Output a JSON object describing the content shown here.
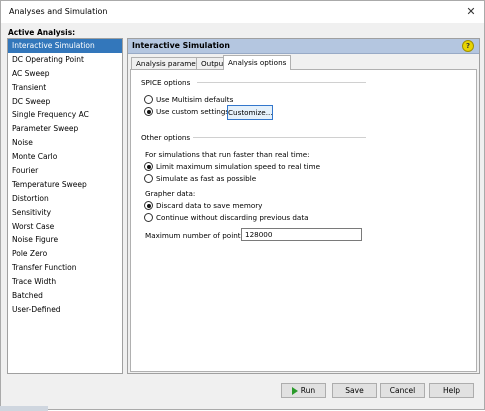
{
  "window": {
    "title": "Analyses and Simulation"
  },
  "sidebar": {
    "label": "Active Analysis:",
    "items": [
      {
        "label": "Interactive Simulation",
        "selected": true
      },
      {
        "label": "DC Operating Point"
      },
      {
        "label": "AC Sweep"
      },
      {
        "label": "Transient"
      },
      {
        "label": "DC Sweep"
      },
      {
        "label": "Single Frequency AC"
      },
      {
        "label": "Parameter Sweep"
      },
      {
        "label": "Noise"
      },
      {
        "label": "Monte Carlo"
      },
      {
        "label": "Fourier"
      },
      {
        "label": "Temperature Sweep"
      },
      {
        "label": "Distortion"
      },
      {
        "label": "Sensitivity"
      },
      {
        "label": "Worst Case"
      },
      {
        "label": "Noise Figure"
      },
      {
        "label": "Pole Zero"
      },
      {
        "label": "Transfer Function"
      },
      {
        "label": "Trace Width"
      },
      {
        "label": "Batched"
      },
      {
        "label": "User-Defined"
      }
    ]
  },
  "panel": {
    "title": "Interactive Simulation",
    "help_icon": "help-icon",
    "tabs": [
      {
        "label": "Analysis parameters"
      },
      {
        "label": "Output"
      },
      {
        "label": "Analysis options",
        "active": true
      }
    ]
  },
  "options": {
    "spice_group": "SPICE options",
    "spice_defaults": "Use Multisim defaults",
    "spice_custom": "Use custom settings",
    "customize_button": "Customize...",
    "other_group": "Other options",
    "faster_label": "For simulations that run faster than real time:",
    "limit_speed": "Limit maximum simulation speed to real time",
    "fast_possible": "Simulate as fast as possible",
    "grapher_label": "Grapher data:",
    "discard_data": "Discard data to save memory",
    "continue_data": "Continue without discarding previous data",
    "max_points_label": "Maximum number of points:",
    "max_points_value": "128000"
  },
  "buttons": {
    "run": "Run",
    "save": "Save",
    "cancel": "Cancel",
    "help": "Help"
  },
  "colors": {
    "selected": "#3377bb",
    "header": "#b4c6e0",
    "run_icon": "#2a9a2a"
  }
}
